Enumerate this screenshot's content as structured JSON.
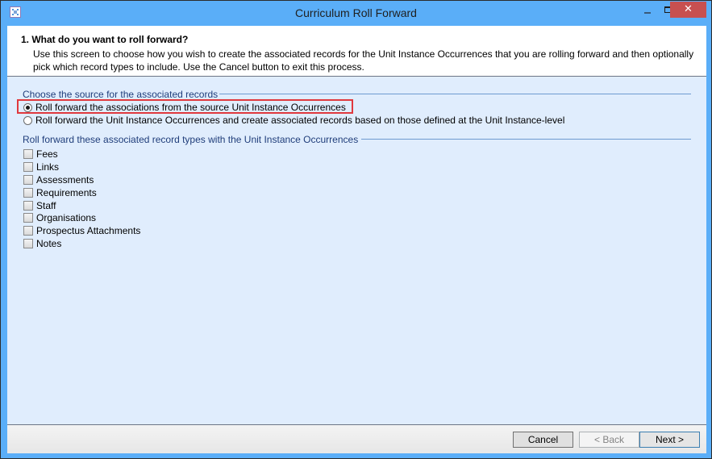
{
  "window": {
    "title": "Curriculum Roll Forward",
    "controls": {
      "minimize_icon": "minimize-icon",
      "maximize_icon": "maximize-icon",
      "close_label": "✕"
    },
    "accent_color": "#5aaef8",
    "close_color": "#c75050"
  },
  "header": {
    "step_title": "1. What do you want to roll forward?",
    "description": "Use this screen to choose how you wish to create the associated records for the Unit Instance Occurrences that you are rolling forward and then optionally pick which record types to include.  Use the Cancel button to exit this process."
  },
  "source_group": {
    "label": "Choose the source for the associated records",
    "options": [
      {
        "label": "Roll forward the associations from the source Unit Instance Occurrences",
        "selected": true,
        "highlighted": true
      },
      {
        "label": "Roll forward the Unit Instance Occurrences and create associated records based on those defined at the Unit Instance-level",
        "selected": false,
        "highlighted": false
      }
    ]
  },
  "record_types_group": {
    "label": "Roll forward these associated record types with the Unit Instance Occurrences",
    "items": [
      {
        "label": "Fees",
        "checked": false
      },
      {
        "label": "Links",
        "checked": false
      },
      {
        "label": "Assessments",
        "checked": false
      },
      {
        "label": "Requirements",
        "checked": false
      },
      {
        "label": "Staff",
        "checked": false
      },
      {
        "label": "Organisations",
        "checked": false
      },
      {
        "label": "Prospectus Attachments",
        "checked": false
      },
      {
        "label": "Notes",
        "checked": false
      }
    ]
  },
  "footer": {
    "cancel_label": "Cancel",
    "back_label": "< Back",
    "back_enabled": false,
    "next_label": "Next >"
  }
}
